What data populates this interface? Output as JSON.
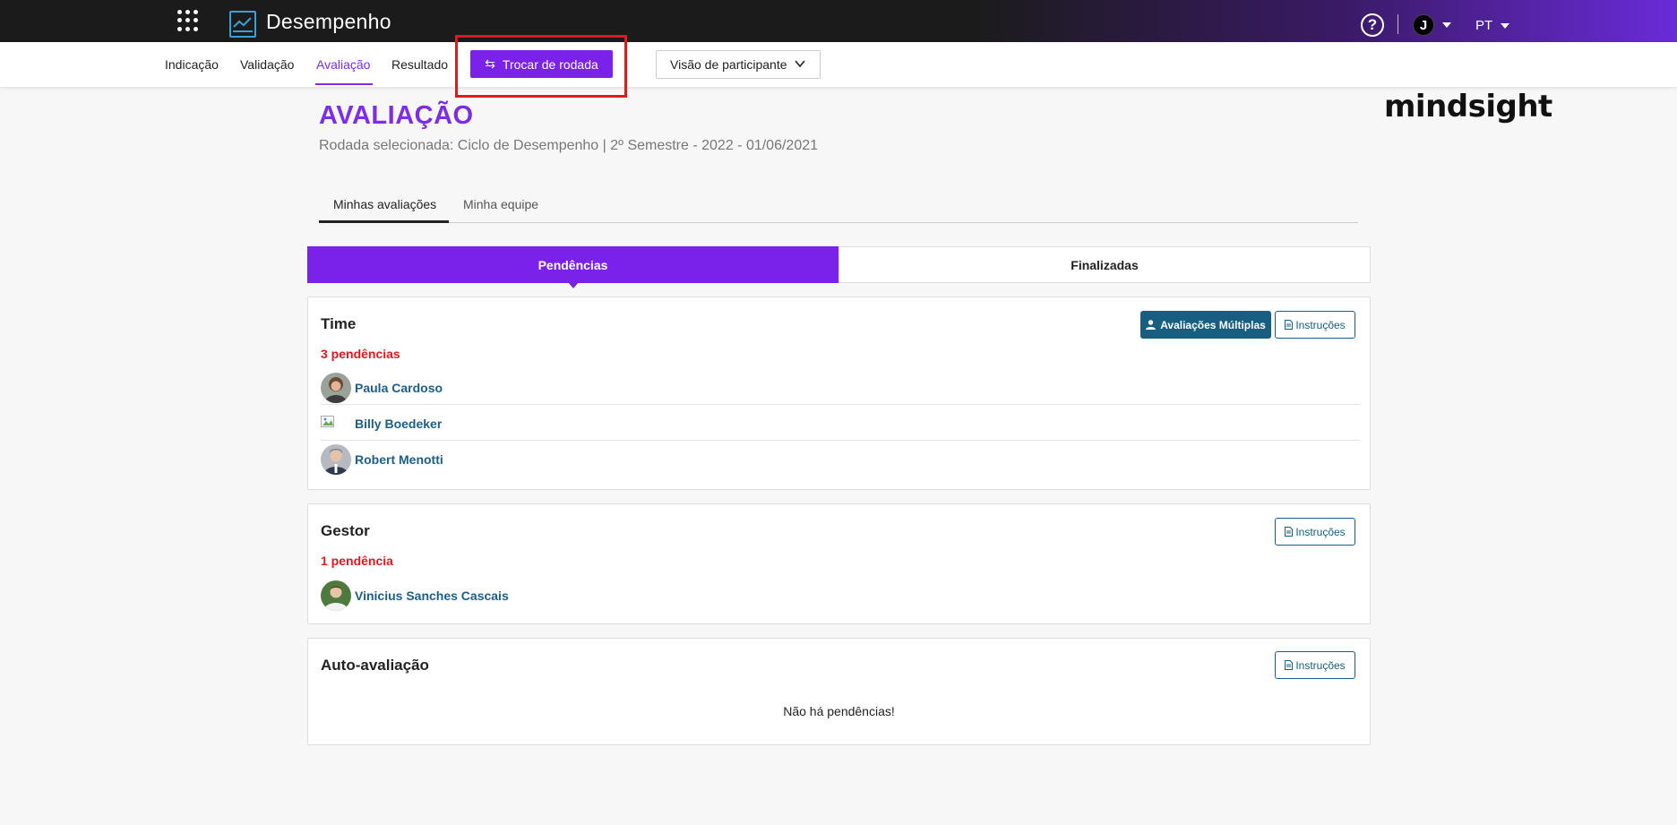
{
  "app": {
    "title": "Desempenho",
    "brand": "mindsight",
    "language": "PT",
    "user_initial": "J",
    "help": "?"
  },
  "nav": {
    "items": [
      "Indicação",
      "Validação",
      "Avaliação",
      "Resultado"
    ],
    "active": "Avaliação",
    "switch_round_label": "Trocar de rodada",
    "view_select": "Visão de participante"
  },
  "page": {
    "title": "AVALIAÇÃO",
    "subtitle": "Rodada selecionada: Ciclo de Desempenho | 2º Semestre - 2022 - 01/06/2021"
  },
  "tabs": [
    "Minhas avaliações",
    "Minha equipe"
  ],
  "segments": [
    "Pendências",
    "Finalizadas"
  ],
  "sections": {
    "time": {
      "title": "Time",
      "count_label": "3 pendências",
      "multi_button": "Avaliações Múltiplas",
      "instructions_button": "Instruções",
      "people": [
        "Paula Cardoso",
        "Billy Boedeker",
        "Robert Menotti"
      ]
    },
    "gestor": {
      "title": "Gestor",
      "count_label": "1 pendência",
      "instructions_button": "Instruções",
      "people": [
        "Vinicius Sanches Cascais"
      ]
    },
    "auto": {
      "title": "Auto-avaliação",
      "instructions_button": "Instruções",
      "empty_message": "Não há pendências!"
    }
  },
  "colors": {
    "accent": "#7b22ea",
    "link": "#1d5e85",
    "danger": "#e0191f",
    "button_dark": "#175e80"
  }
}
